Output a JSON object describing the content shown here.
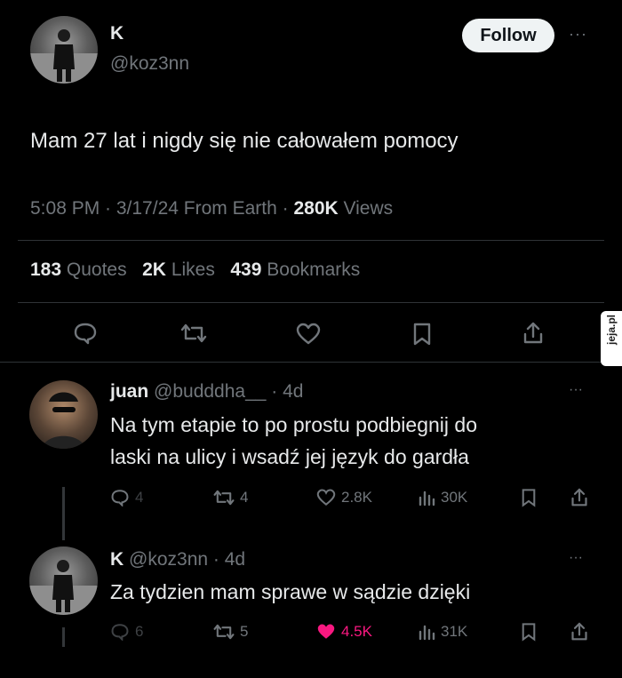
{
  "main_tweet": {
    "display_name": "K",
    "handle": "@koz3nn",
    "follow_label": "Follow",
    "text": "Mam 27 lat i nigdy się nie całowałem pomocy",
    "time": "5:08 PM · 3/17/24 From Earth ·",
    "views_count": "280K",
    "views_label": "Views",
    "quotes_count": "183",
    "quotes_label": "Quotes",
    "likes_count": "2K",
    "likes_label": "Likes",
    "bookmarks_count": "439",
    "bookmarks_label": "Bookmarks"
  },
  "replies": [
    {
      "display_name": "juan",
      "handle": "@budddha__",
      "age": "· 4d",
      "text_line1": "Na tym etapie to po prostu podbiegnij do",
      "text_line2": "laski na ulicy i wsadź jej język do gardła",
      "replies": "4",
      "retweets": "4",
      "likes": "2.8K",
      "views": "30K"
    },
    {
      "display_name": "K",
      "handle": "@koz3nn",
      "age": "· 4d",
      "text_line1": "Za tydzien mam sprawe w sądzie dzięki",
      "replies": "6",
      "retweets": "5",
      "likes": "4.5K",
      "views": "31K"
    }
  ],
  "watermark": "jeja.pl",
  "colors": {
    "like_active": "#f91880",
    "muted": "#71767b"
  }
}
